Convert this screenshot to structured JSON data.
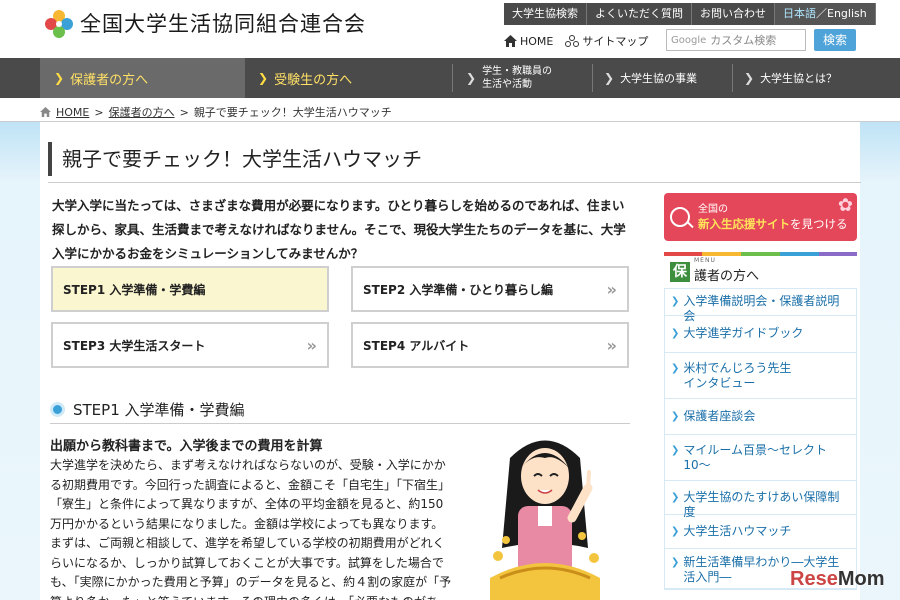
{
  "header": {
    "site_title": "全国大学生活協同組合連合会",
    "util_nav": [
      "大学生協検索",
      "よくいただく質問",
      "お問い合わせ"
    ],
    "lang_ja": "日本語",
    "lang_sep": "／",
    "lang_en": "English",
    "home_label": "HOME",
    "sitemap_label": "サイトマップ",
    "search_placeholder": "カスタム検索",
    "search_brand": "Google",
    "search_button": "検索"
  },
  "main_nav": [
    {
      "label": "保護者の方へ",
      "active": true
    },
    {
      "label": "受験生の方へ"
    },
    {
      "label_line1": "学生・教職員の",
      "label_line2": "生活や活動"
    },
    {
      "label": "大学生協の事業"
    },
    {
      "label": "大学生協とは？"
    }
  ],
  "breadcrumb": {
    "home": "HOME",
    "parent": "保護者の方へ",
    "current": "親子で要チェック！大学生活ハウマッチ",
    "sep": ">"
  },
  "page_title": "親子で要チェック！大学生活ハウマッチ",
  "intro_text": "大学入学に当たっては、さまざまな費用が必要になります。ひとり暮らしを始めるのであれば、住まい探しから、家具、生活費まで考えなければなりません。そこで、現役大学生たちのデータを基に、大学入学にかかるお金をシミュレーションしてみませんか？",
  "steps": [
    {
      "label": "STEP1 入学準備・学費編"
    },
    {
      "label": "STEP2 入学準備・ひとり暮らし編"
    },
    {
      "label": "STEP3 大学生活スタート"
    },
    {
      "label": "STEP4 アルバイト"
    }
  ],
  "section": {
    "heading": "STEP1 入学準備・学費編",
    "subheading": "出願から教科書まで。入学後までの費用を計算",
    "body": "大学進学を決めたら、まず考えなければならないのが、受験・入学にかかる初期費用です。今回行った調査によると、金額こそ「自宅生」「下宿生」「寮生」と条件によって異なりますが、全体の平均金額を見ると、約150万円かかるという結果になりました。金額は学校によっても異なります。まずは、ご両親と相談して、進学を希望している学校の初期費用がどれくらいになるか、しっかり試算しておくことが大事です。試算をした場合でも、「実際にかかった費用と予算」のデータを見ると、約４割の家庭が「予算より多かった」と答えています。その理由の多くは、「必要なものがあった」とい"
  },
  "sidebar": {
    "banner_line1": "全国の",
    "banner_highlight": "新入生応援サイト",
    "banner_suffix": "を見つける",
    "menu_small": "MENU",
    "menu_icon": "保",
    "menu_title": "護者の方へ",
    "items": [
      {
        "label": "入学準備説明会・保護者説明会"
      },
      {
        "label": "大学進学ガイドブック"
      },
      {
        "label": "米村でんじろう先生インタビュー"
      },
      {
        "label": "保護者座談会"
      },
      {
        "label": "マイルーム百景～セレクト10～"
      },
      {
        "label": "大学生協のたすけあい保障制度"
      },
      {
        "label": "大学生活ハウマッチ"
      },
      {
        "label": "新生活準備早わかり―大学生活入門―"
      }
    ]
  },
  "watermark": {
    "part1": "Rese",
    "part2": "Mom"
  },
  "colors": {
    "accent_blue": "#3aa0d8",
    "nav_dark": "#4a4a4a",
    "banner_red": "#e5475a",
    "step_active": "#faf6cf"
  }
}
